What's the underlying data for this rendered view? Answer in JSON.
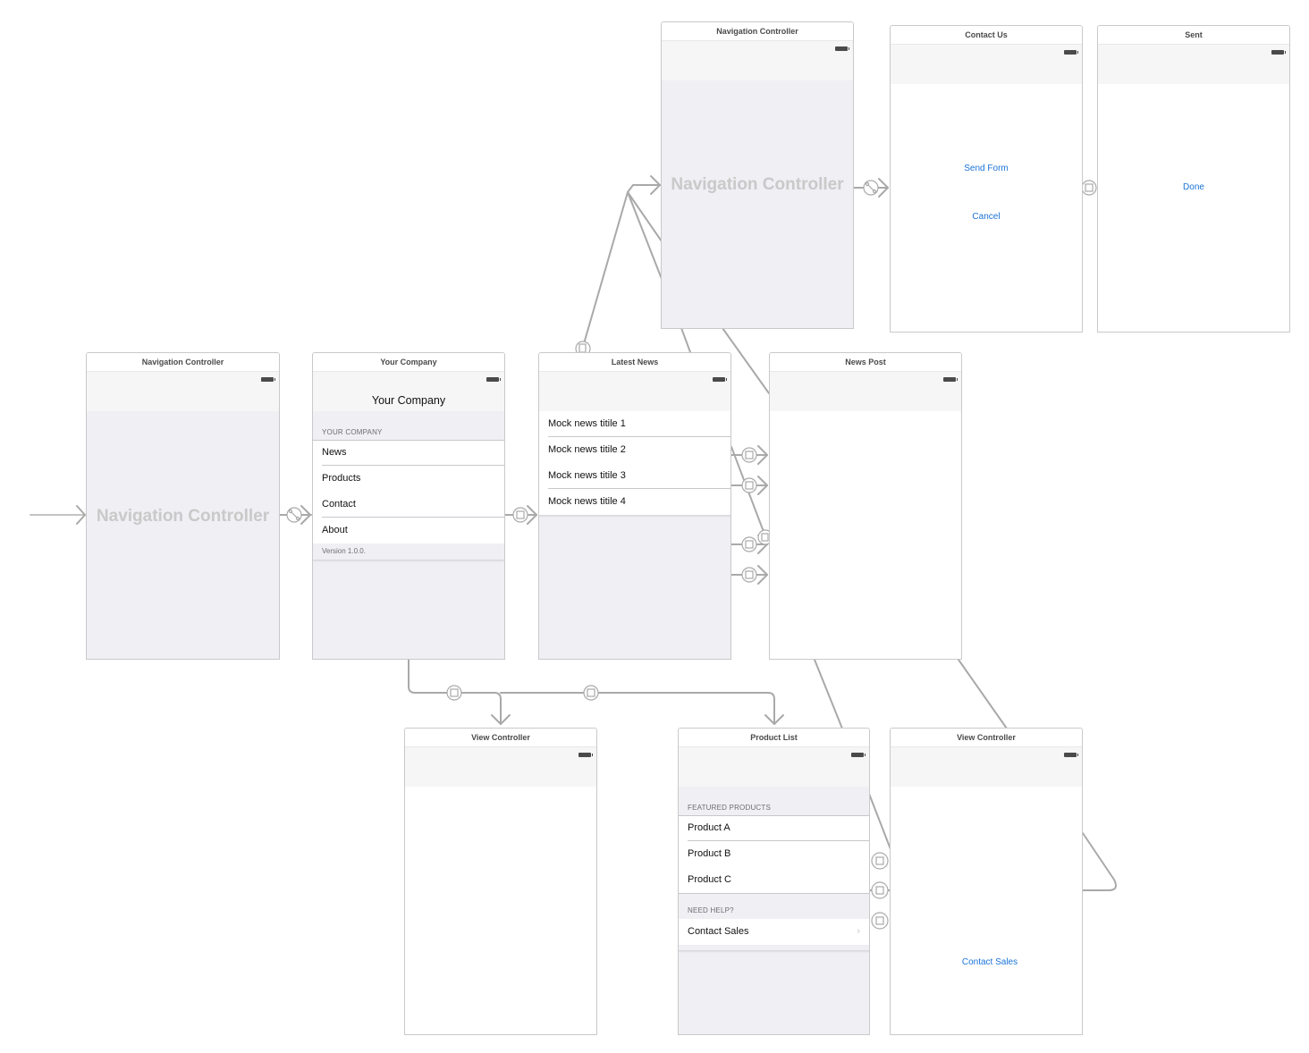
{
  "storyboard": {
    "entry_arrow": "initial-view-controller-arrow",
    "scenes": {
      "nav_main": {
        "title": "Navigation Controller",
        "placeholder": "Navigation Controller"
      },
      "your_company": {
        "title": "Your Company",
        "nav_title": "Your Company",
        "section_header": "YOUR COMPANY",
        "rows": [
          "News",
          "Products",
          "Contact",
          "About"
        ],
        "footer": "Version 1.0.0."
      },
      "latest_news": {
        "title": "Latest News",
        "rows": [
          "Mock news titile 1",
          "Mock news titile 2",
          "Mock news titile 3",
          "Mock news titile 4"
        ]
      },
      "news_post": {
        "title": "News Post"
      },
      "nav_contact": {
        "title": "Navigation Controller",
        "placeholder": "Navigation Controller"
      },
      "contact_us": {
        "title": "Contact Us",
        "buttons": [
          "Send Form",
          "Cancel"
        ]
      },
      "sent": {
        "title": "Sent",
        "buttons": [
          "Done"
        ]
      },
      "view_controller_about": {
        "title": "View Controller"
      },
      "product_list": {
        "title": "Product List",
        "section1_header": "FEATURED PRODUCTS",
        "section1_rows": [
          "Product A",
          "Product B",
          "Product C"
        ],
        "section2_header": "NEED HELP?",
        "section2_rows": [
          "Contact Sales"
        ],
        "chevron": "›"
      },
      "view_controller_sales": {
        "title": "View Controller",
        "buttons": [
          "Contact Sales"
        ]
      }
    },
    "segue_types": {
      "relationship": "relationship-segue-icon",
      "show": "show-segue-icon",
      "present": "present-modally-segue-icon"
    },
    "colors": {
      "link": "#1a73d9",
      "segue_line": "#a9a9a9",
      "placeholder_text": "#c9c9c9",
      "canvas": "#ffffff",
      "scene_gray": "#efeff4"
    }
  }
}
